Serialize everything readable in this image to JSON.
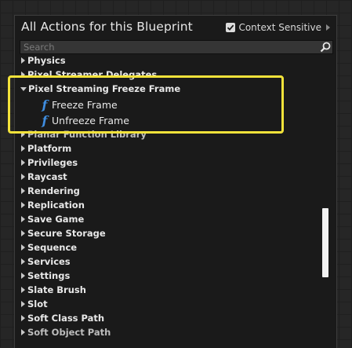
{
  "panel": {
    "title": "All Actions for this Blueprint",
    "context_sensitive": {
      "label": "Context Sensitive",
      "checked": true
    }
  },
  "search": {
    "placeholder": "Search",
    "value": ""
  },
  "categories_top": [
    {
      "label": "Physics"
    },
    {
      "label": "Pixel Streamer Delegates"
    }
  ],
  "expanded_category": {
    "label": "Pixel Streaming Freeze Frame",
    "functions": [
      {
        "label": "Freeze Frame",
        "icon": "function-icon"
      },
      {
        "label": "Unfreeze Frame",
        "icon": "function-icon"
      }
    ]
  },
  "categories": [
    {
      "label": "Planar Function Library"
    },
    {
      "label": "Platform"
    },
    {
      "label": "Privileges"
    },
    {
      "label": "Raycast"
    },
    {
      "label": "Rendering"
    },
    {
      "label": "Replication"
    },
    {
      "label": "Save Game"
    },
    {
      "label": "Secure Storage"
    },
    {
      "label": "Sequence"
    },
    {
      "label": "Services"
    },
    {
      "label": "Settings"
    },
    {
      "label": "Slate Brush"
    },
    {
      "label": "Slot"
    },
    {
      "label": "Soft Class Path"
    },
    {
      "label": "Soft Object Path"
    }
  ],
  "colors": {
    "highlight": "#f2e23a",
    "function_icon": "#3f8de0",
    "panel_bg": "#1a1a1a"
  }
}
